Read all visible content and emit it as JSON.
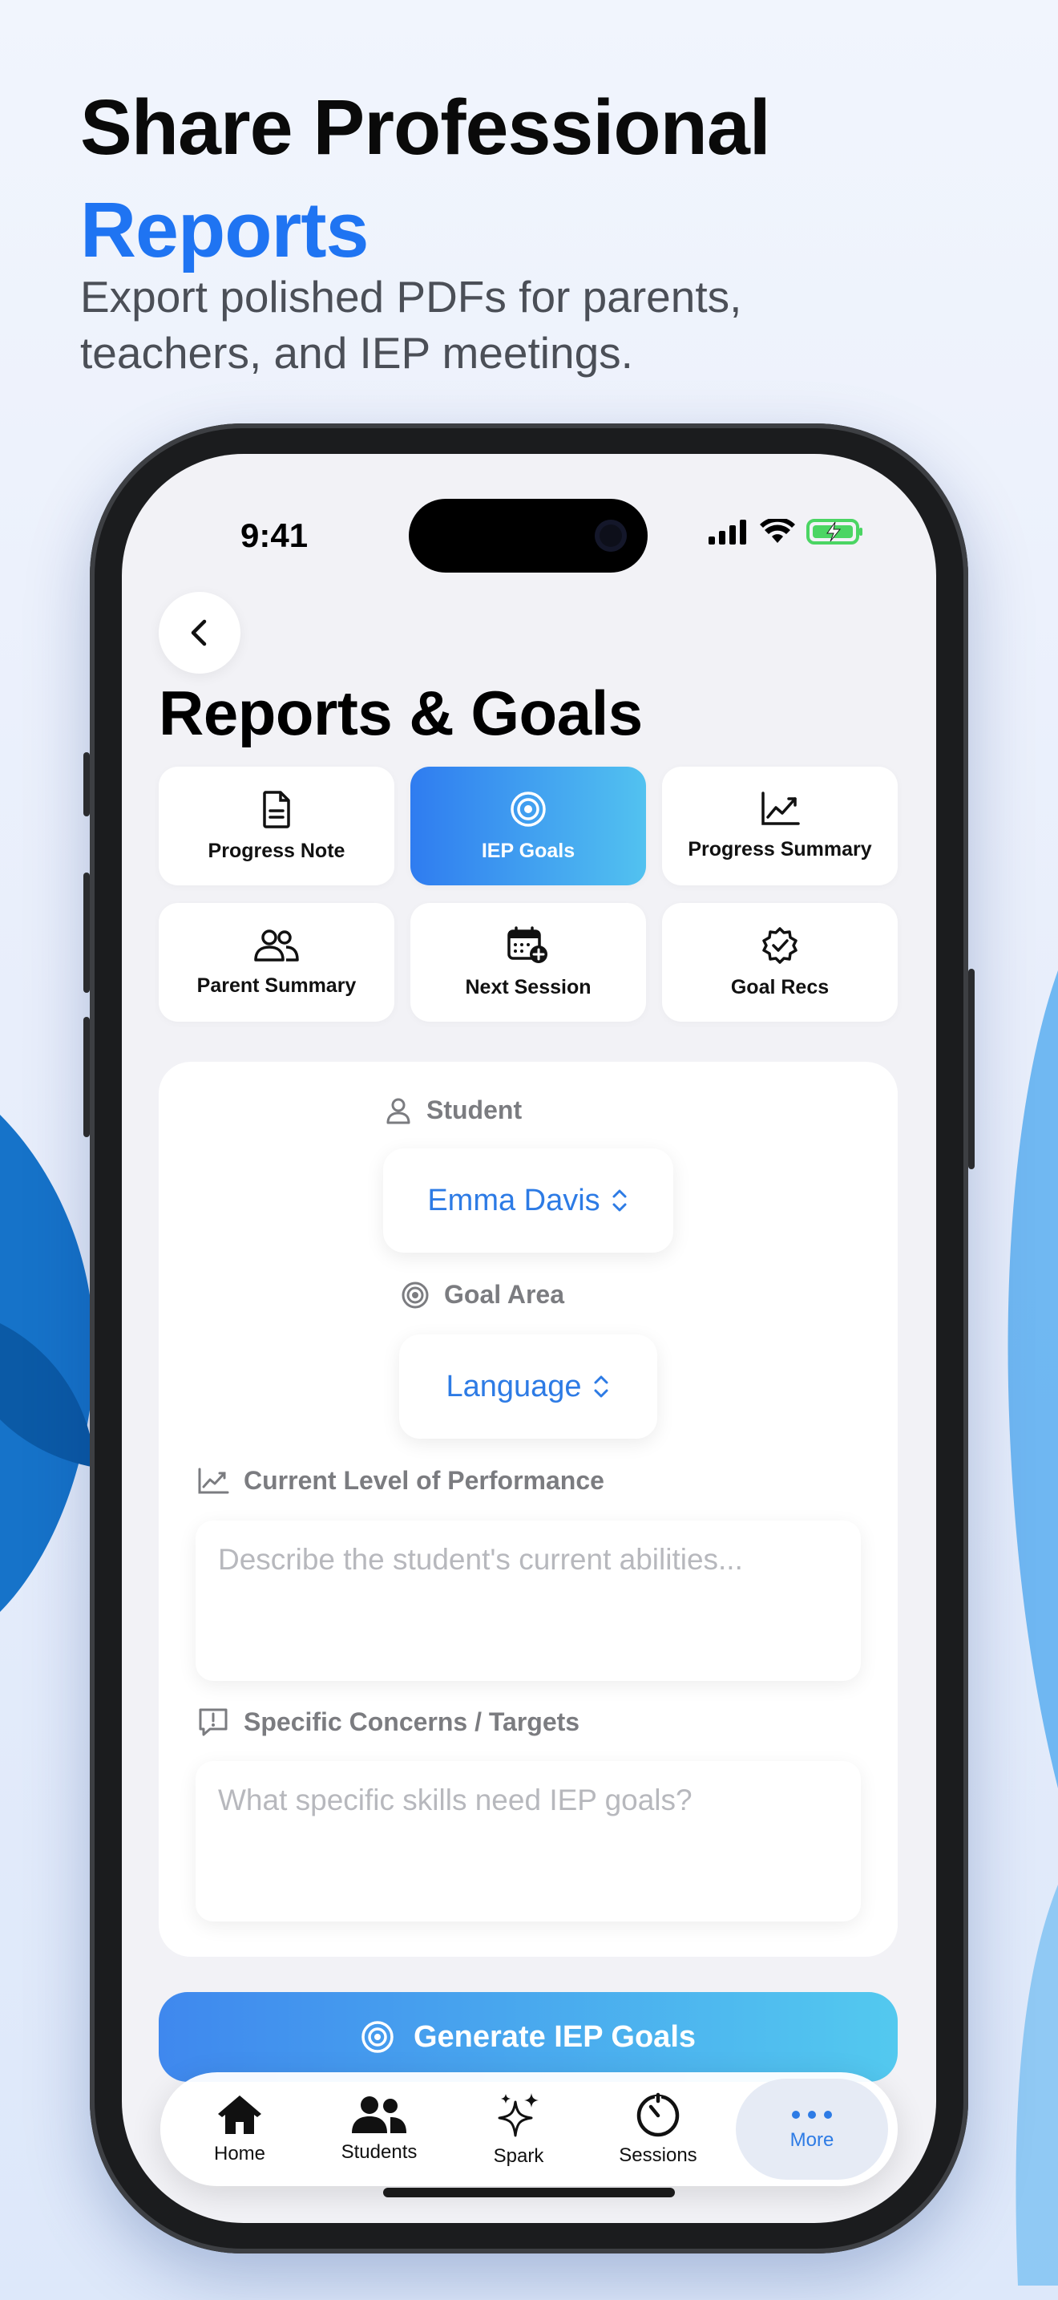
{
  "headline": {
    "line1": "Share Professional",
    "line2": "Reports"
  },
  "subhead": "Export polished PDFs for parents, teachers, and IEP meetings.",
  "status_bar": {
    "time": "9:41"
  },
  "page": {
    "title": "Reports & Goals"
  },
  "tiles": [
    {
      "label": "Progress Note",
      "icon": "document-icon",
      "active": false
    },
    {
      "label": "IEP Goals",
      "icon": "target-icon",
      "active": true
    },
    {
      "label": "Progress Summary",
      "icon": "chart-line-icon",
      "active": false
    },
    {
      "label": "Parent Summary",
      "icon": "people-icon",
      "active": false
    },
    {
      "label": "Next Session",
      "icon": "calendar-plus-icon",
      "active": false
    },
    {
      "label": "Goal Recs",
      "icon": "badge-check-icon",
      "active": false
    }
  ],
  "form": {
    "student_label": "Student",
    "student_value": "Emma Davis",
    "goal_area_label": "Goal Area",
    "goal_area_value": "Language",
    "performance_label": "Current Level of Performance",
    "performance_placeholder": "Describe the student's current abilities...",
    "concerns_label": "Specific Concerns / Targets",
    "concerns_placeholder": "What specific skills need IEP goals?"
  },
  "generate_button": {
    "label": "Generate IEP Goals"
  },
  "tabbar": [
    {
      "label": "Home",
      "icon": "house-icon"
    },
    {
      "label": "Students",
      "icon": "people-icon"
    },
    {
      "label": "Spark",
      "icon": "sparkles-icon"
    },
    {
      "label": "Sessions",
      "icon": "timer-icon"
    },
    {
      "label": "More",
      "icon": "ellipsis-icon",
      "selected": true
    }
  ],
  "colors": {
    "accent": "#1f74f2",
    "picker_text": "#2d7be5",
    "gradient_start": "#3f88ee",
    "gradient_end": "#53c9ef"
  }
}
